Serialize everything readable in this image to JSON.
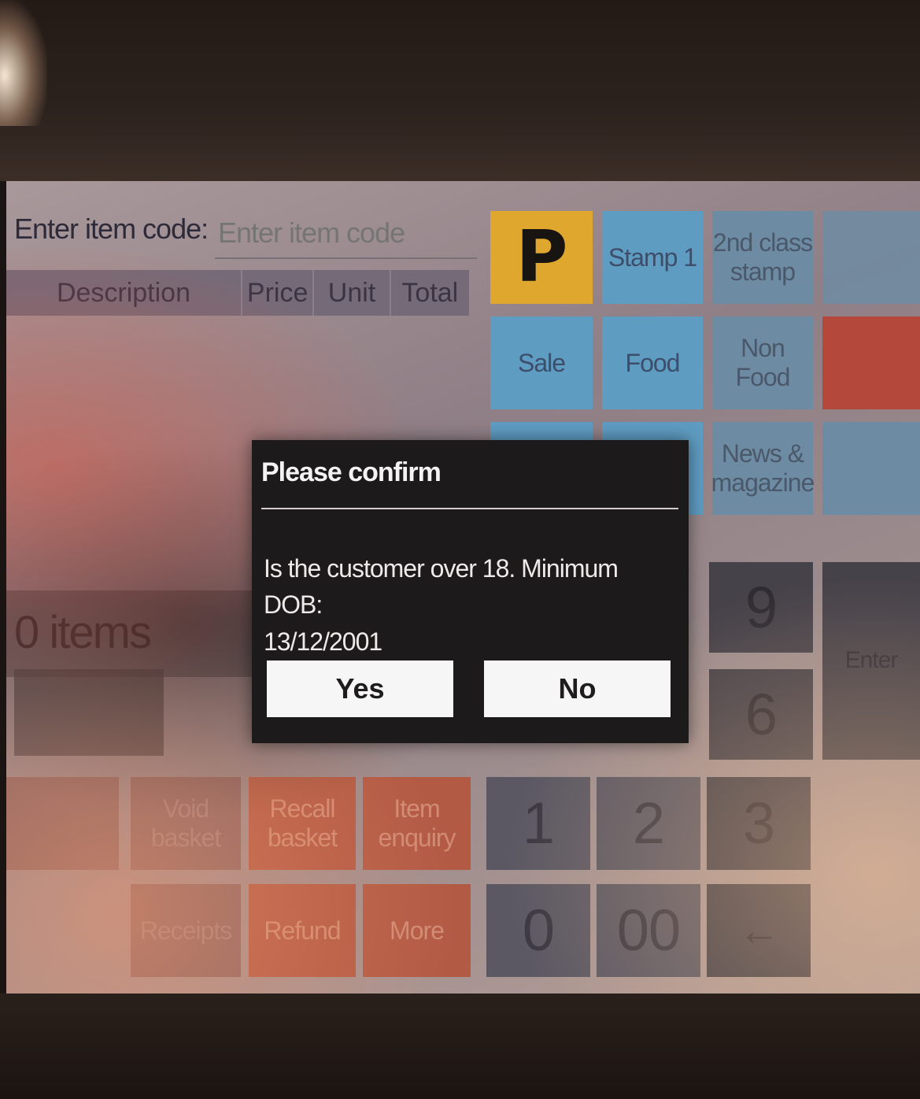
{
  "header": {
    "item_code_label": "Enter item code:",
    "item_code_placeholder": "Enter item code"
  },
  "table": {
    "columns": [
      "Description",
      "Price",
      "Unit",
      "Total"
    ]
  },
  "quick_keys": [
    {
      "label": "P",
      "icon": "payzone-logo-icon"
    },
    {
      "label": "Stamp 1"
    },
    {
      "label": "2nd class stamp"
    },
    {
      "label": "Sale"
    },
    {
      "label": "Food"
    },
    {
      "label": "Non Food"
    },
    {
      "label": "News & magazine"
    }
  ],
  "items_label": "0 items",
  "actions": {
    "void_basket": "Void basket",
    "recall_basket": "Recall basket",
    "item_enquiry": "Item enquiry",
    "receipts": "Receipts",
    "refund": "Refund",
    "more": "More"
  },
  "keypad": {
    "k9": "9",
    "k6": "6",
    "k1": "1",
    "k2": "2",
    "k3": "3",
    "k0": "0",
    "k00": "00",
    "backspace": "←",
    "enter": "Enter"
  },
  "dialog": {
    "title": "Please confirm",
    "message_line1": "Is the customer over 18. Minimum DOB:",
    "message_line2": "13/12/2001",
    "yes_label": "Yes",
    "no_label": "No"
  },
  "colors": {
    "accent_blue": "#5f9cc2",
    "logo_orange": "#e0a72f",
    "action_red": "#b25a44",
    "dialog_bg": "#1d1a1b"
  }
}
